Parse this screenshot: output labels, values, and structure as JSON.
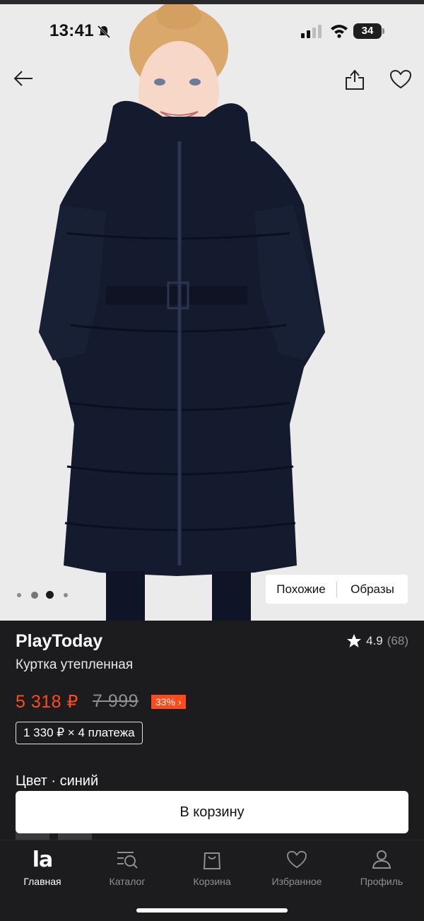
{
  "status_bar": {
    "time": "13:41",
    "battery": "34"
  },
  "nav": {
    "back_icon": "arrow-left-icon",
    "share_icon": "share-icon",
    "favorite_icon": "heart-icon"
  },
  "gallery": {
    "dots_total": 4,
    "active_dot": 3
  },
  "segments": {
    "similar": "Похожие",
    "looks": "Образы"
  },
  "product": {
    "brand": "PlayToday",
    "title": "Куртка утепленная",
    "rating": "4.9",
    "reviews": "(68)",
    "price": "5 318 ₽",
    "old_price": "7 999",
    "discount": "33% ›",
    "installment": "1 330 ₽ × 4 платежа",
    "color_label": "Цвет · синий"
  },
  "cta": {
    "label": "В корзину"
  },
  "tabbar": {
    "items": [
      {
        "label": "Главная",
        "icon": "la-logo-icon",
        "active": true
      },
      {
        "label": "Каталог",
        "icon": "catalog-search-icon",
        "active": false
      },
      {
        "label": "Корзина",
        "icon": "bag-icon",
        "active": false
      },
      {
        "label": "Избранное",
        "icon": "heart-icon",
        "active": false
      },
      {
        "label": "Профиль",
        "icon": "profile-icon",
        "active": false
      }
    ],
    "logo_text": "la"
  },
  "colors": {
    "accent": "#ff4a1c",
    "background": "#1c1c1e",
    "coat": "#141b2e"
  }
}
